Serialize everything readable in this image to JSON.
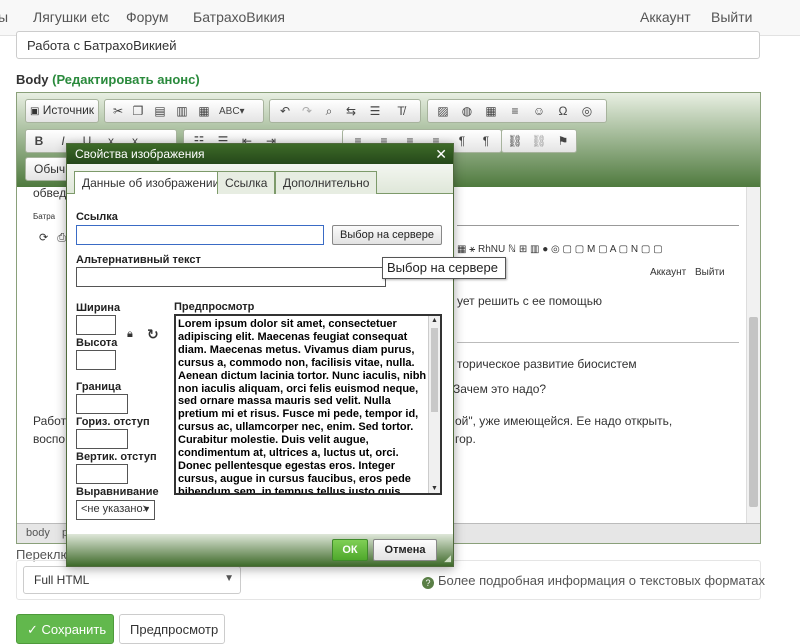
{
  "nav": {
    "items": [
      "ы",
      "Лягушки etc",
      "Форум",
      "БатрахоВикия"
    ],
    "right": [
      "Аккаунт",
      "Выйти"
    ]
  },
  "form": {
    "title_value": "Работа с БатрахоВикией",
    "body_label": "Body",
    "body_edit": "(Редактировать анонс)",
    "switch_label": "Переключ",
    "format_value": "Full HTML",
    "format_help": "Более подробная информация о текстовых форматах",
    "save_label": "✓ Сохранить",
    "preview_label": "Предпросмотр"
  },
  "editor": {
    "source_label": "Источник",
    "format_label": "Обыч",
    "status_items": [
      "body",
      "p"
    ],
    "background_lines": [
      "обвед",
      "Батра",
      "Работ",
      "воспо"
    ],
    "background_right": [
      "ует решить с ее помощью",
      "торическое развитие биосистем",
      "Зачем это надо?",
      "ой\", уже имеющейся. Ее надо открыть,",
      "гор."
    ],
    "bg_toolbar_text": "RhNU",
    "bg_nav": [
      "Аккаунт",
      "Выйти"
    ]
  },
  "dialog": {
    "title": "Свойства изображения",
    "tabs": [
      "Данные об изображении",
      "Ссылка",
      "Дополнительно"
    ],
    "url_label": "Ссылка",
    "url_value": "",
    "browse_label": "Выбор на сервере",
    "tooltip": "Выбор на сервере",
    "alt_label": "Альтернативный текст",
    "width_label": "Ширина",
    "height_label": "Высота",
    "border_label": "Граница",
    "hspace_label": "Гориз. отступ",
    "vspace_label": "Вертик. отступ",
    "align_label": "Выравнивание",
    "align_value": "<не указано>",
    "preview_label": "Предпросмотр",
    "preview_text": "Lorem ipsum dolor sit amet, consectetuer adipiscing elit. Maecenas feugiat consequat diam. Maecenas metus. Vivamus diam purus, cursus a, commodo non, facilisis vitae, nulla. Aenean dictum lacinia tortor. Nunc iaculis, nibh non iaculis aliquam, orci felis euismod neque, sed ornare massa mauris sed velit. Nulla pretium mi et risus. Fusce mi pede, tempor id, cursus ac, ullamcorper nec, enim. Sed tortor. Curabitur molestie. Duis velit augue, condimentum at, ultrices a, luctus ut, orci. Donec pellentesque egestas eros. Integer cursus, augue in cursus faucibus, eros pede bibendum sem, in tempus tellus justo quis ligula. Etiam eget tortor.",
    "ok_label": "ОК",
    "cancel_label": "Отмена"
  }
}
